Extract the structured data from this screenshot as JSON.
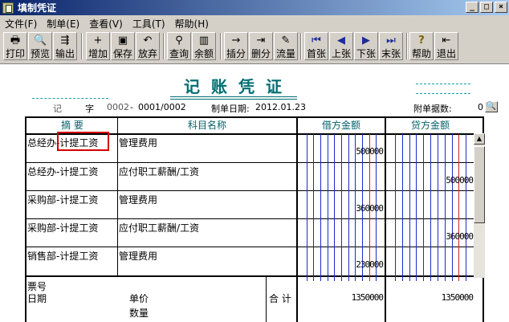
{
  "window": {
    "title": "填制凭证",
    "min": "_",
    "max": "□",
    "close": "×"
  },
  "menu": [
    "文件(F)",
    "制单(E)",
    "查看(V)",
    "工具(T)",
    "帮助(H)"
  ],
  "toolbar": [
    {
      "label": "打印",
      "icon": "printer-icon",
      "glyph": "🖶"
    },
    {
      "label": "预览",
      "icon": "preview-icon",
      "glyph": "🔍"
    },
    {
      "label": "输出",
      "icon": "export-icon",
      "glyph": "⇶"
    },
    {
      "label": "增加",
      "icon": "add-icon",
      "glyph": "+"
    },
    {
      "label": "保存",
      "icon": "save-icon",
      "glyph": "▣"
    },
    {
      "label": "放弃",
      "icon": "undo-icon",
      "glyph": "↶"
    },
    {
      "label": "查询",
      "icon": "binoculars-icon",
      "glyph": "⚲"
    },
    {
      "label": "余额",
      "icon": "balance-chart-icon",
      "glyph": "▥"
    },
    {
      "label": "插分",
      "icon": "insert-row-icon",
      "glyph": "→"
    },
    {
      "label": "删分",
      "icon": "delete-row-icon",
      "glyph": "⇥"
    },
    {
      "label": "流量",
      "icon": "cashflow-icon",
      "glyph": "✎"
    },
    {
      "label": "首张",
      "icon": "first-icon",
      "glyph": "⏮"
    },
    {
      "label": "上张",
      "icon": "prev-icon",
      "glyph": "◀"
    },
    {
      "label": "下张",
      "icon": "next-icon",
      "glyph": "▶"
    },
    {
      "label": "末张",
      "icon": "last-icon",
      "glyph": "⏭"
    },
    {
      "label": "帮助",
      "icon": "help-icon",
      "glyph": "?"
    },
    {
      "label": "退出",
      "icon": "exit-icon",
      "glyph": "⇤"
    }
  ],
  "voucher": {
    "title": "记账凭证",
    "type_label": "记",
    "number_label": "字",
    "number_prefix": "0002",
    "number_sep": "-",
    "number": "0001/0002",
    "date_label": "制单日期:",
    "date": "2012.01.23",
    "attach_label": "附单据数:",
    "attach_count": "0",
    "headers": {
      "summary": "摘 要",
      "account": "科目名称",
      "debit": "借方金额",
      "credit": "贷方金额"
    },
    "rows": [
      {
        "summary": "总经办-计提工资",
        "account": "管理费用",
        "debit": "500000",
        "credit": ""
      },
      {
        "summary": "总经办-计提工资",
        "account": "应付职工薪酬/工资",
        "debit": "",
        "credit": "500000"
      },
      {
        "summary": "采购部-计提工资",
        "account": "管理费用",
        "debit": "360000",
        "credit": ""
      },
      {
        "summary": "采购部-计提工资",
        "account": "应付职工薪酬/工资",
        "debit": "",
        "credit": "360000"
      },
      {
        "summary": "销售部-计提工资",
        "account": "管理费用",
        "debit": "230000",
        "credit": ""
      }
    ],
    "footer": {
      "ticket_label": "票号",
      "date_label": "日期",
      "price_label": "单价",
      "qty_label": "数量",
      "total_label": "合 计",
      "debit_total": "1350000",
      "credit_total": "1350000"
    }
  },
  "colors": {
    "title": "#006e72",
    "grid_blue": "#1e2ac8",
    "grid_red": "#d82020"
  }
}
